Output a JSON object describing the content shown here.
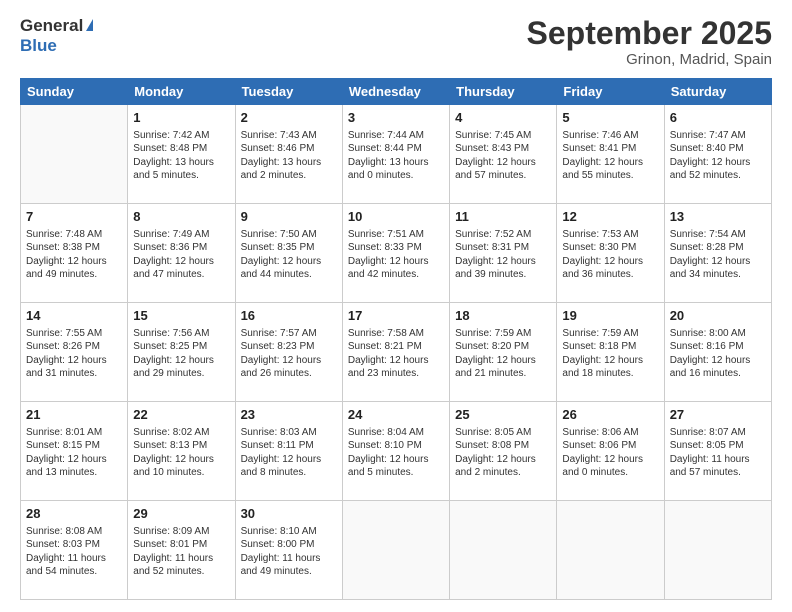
{
  "header": {
    "logo_general": "General",
    "logo_blue": "Blue",
    "month_title": "September 2025",
    "location": "Grinon, Madrid, Spain"
  },
  "days_of_week": [
    "Sunday",
    "Monday",
    "Tuesday",
    "Wednesday",
    "Thursday",
    "Friday",
    "Saturday"
  ],
  "weeks": [
    [
      {
        "num": "",
        "info": ""
      },
      {
        "num": "1",
        "info": "Sunrise: 7:42 AM\nSunset: 8:48 PM\nDaylight: 13 hours\nand 5 minutes."
      },
      {
        "num": "2",
        "info": "Sunrise: 7:43 AM\nSunset: 8:46 PM\nDaylight: 13 hours\nand 2 minutes."
      },
      {
        "num": "3",
        "info": "Sunrise: 7:44 AM\nSunset: 8:44 PM\nDaylight: 13 hours\nand 0 minutes."
      },
      {
        "num": "4",
        "info": "Sunrise: 7:45 AM\nSunset: 8:43 PM\nDaylight: 12 hours\nand 57 minutes."
      },
      {
        "num": "5",
        "info": "Sunrise: 7:46 AM\nSunset: 8:41 PM\nDaylight: 12 hours\nand 55 minutes."
      },
      {
        "num": "6",
        "info": "Sunrise: 7:47 AM\nSunset: 8:40 PM\nDaylight: 12 hours\nand 52 minutes."
      }
    ],
    [
      {
        "num": "7",
        "info": "Sunrise: 7:48 AM\nSunset: 8:38 PM\nDaylight: 12 hours\nand 49 minutes."
      },
      {
        "num": "8",
        "info": "Sunrise: 7:49 AM\nSunset: 8:36 PM\nDaylight: 12 hours\nand 47 minutes."
      },
      {
        "num": "9",
        "info": "Sunrise: 7:50 AM\nSunset: 8:35 PM\nDaylight: 12 hours\nand 44 minutes."
      },
      {
        "num": "10",
        "info": "Sunrise: 7:51 AM\nSunset: 8:33 PM\nDaylight: 12 hours\nand 42 minutes."
      },
      {
        "num": "11",
        "info": "Sunrise: 7:52 AM\nSunset: 8:31 PM\nDaylight: 12 hours\nand 39 minutes."
      },
      {
        "num": "12",
        "info": "Sunrise: 7:53 AM\nSunset: 8:30 PM\nDaylight: 12 hours\nand 36 minutes."
      },
      {
        "num": "13",
        "info": "Sunrise: 7:54 AM\nSunset: 8:28 PM\nDaylight: 12 hours\nand 34 minutes."
      }
    ],
    [
      {
        "num": "14",
        "info": "Sunrise: 7:55 AM\nSunset: 8:26 PM\nDaylight: 12 hours\nand 31 minutes."
      },
      {
        "num": "15",
        "info": "Sunrise: 7:56 AM\nSunset: 8:25 PM\nDaylight: 12 hours\nand 29 minutes."
      },
      {
        "num": "16",
        "info": "Sunrise: 7:57 AM\nSunset: 8:23 PM\nDaylight: 12 hours\nand 26 minutes."
      },
      {
        "num": "17",
        "info": "Sunrise: 7:58 AM\nSunset: 8:21 PM\nDaylight: 12 hours\nand 23 minutes."
      },
      {
        "num": "18",
        "info": "Sunrise: 7:59 AM\nSunset: 8:20 PM\nDaylight: 12 hours\nand 21 minutes."
      },
      {
        "num": "19",
        "info": "Sunrise: 7:59 AM\nSunset: 8:18 PM\nDaylight: 12 hours\nand 18 minutes."
      },
      {
        "num": "20",
        "info": "Sunrise: 8:00 AM\nSunset: 8:16 PM\nDaylight: 12 hours\nand 16 minutes."
      }
    ],
    [
      {
        "num": "21",
        "info": "Sunrise: 8:01 AM\nSunset: 8:15 PM\nDaylight: 12 hours\nand 13 minutes."
      },
      {
        "num": "22",
        "info": "Sunrise: 8:02 AM\nSunset: 8:13 PM\nDaylight: 12 hours\nand 10 minutes."
      },
      {
        "num": "23",
        "info": "Sunrise: 8:03 AM\nSunset: 8:11 PM\nDaylight: 12 hours\nand 8 minutes."
      },
      {
        "num": "24",
        "info": "Sunrise: 8:04 AM\nSunset: 8:10 PM\nDaylight: 12 hours\nand 5 minutes."
      },
      {
        "num": "25",
        "info": "Sunrise: 8:05 AM\nSunset: 8:08 PM\nDaylight: 12 hours\nand 2 minutes."
      },
      {
        "num": "26",
        "info": "Sunrise: 8:06 AM\nSunset: 8:06 PM\nDaylight: 12 hours\nand 0 minutes."
      },
      {
        "num": "27",
        "info": "Sunrise: 8:07 AM\nSunset: 8:05 PM\nDaylight: 11 hours\nand 57 minutes."
      }
    ],
    [
      {
        "num": "28",
        "info": "Sunrise: 8:08 AM\nSunset: 8:03 PM\nDaylight: 11 hours\nand 54 minutes."
      },
      {
        "num": "29",
        "info": "Sunrise: 8:09 AM\nSunset: 8:01 PM\nDaylight: 11 hours\nand 52 minutes."
      },
      {
        "num": "30",
        "info": "Sunrise: 8:10 AM\nSunset: 8:00 PM\nDaylight: 11 hours\nand 49 minutes."
      },
      {
        "num": "",
        "info": ""
      },
      {
        "num": "",
        "info": ""
      },
      {
        "num": "",
        "info": ""
      },
      {
        "num": "",
        "info": ""
      }
    ]
  ]
}
